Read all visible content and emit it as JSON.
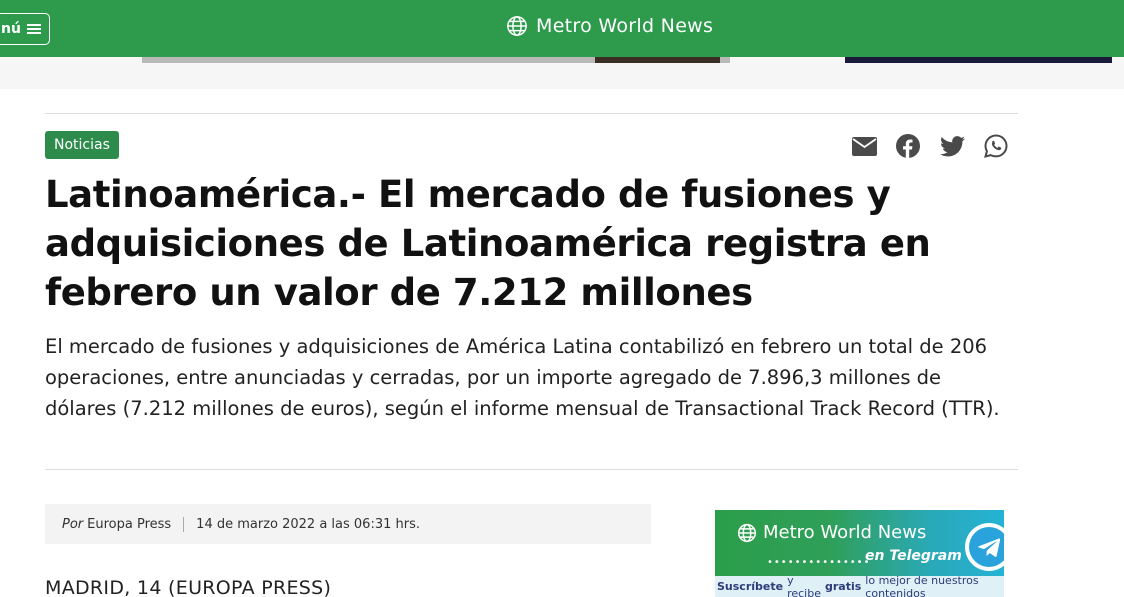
{
  "header": {
    "menu_label": "nú",
    "brand": "Metro World News"
  },
  "article": {
    "category": "Noticias",
    "title": "Latinoamérica.- El mercado de fusiones y adquisiciones de Latinoamérica registra en febrero un valor de 7.212 millones",
    "lede": "El mercado de fusiones y adquisiciones de América Latina contabilizó en febrero un total de 206 operaciones, entre anunciadas y cerradas, por un importe agregado de 7.896,3 millones de dólares (7.212 millones de euros), según el informe mensual de Transactional Track Record (TTR).",
    "byline_prefix": "Por",
    "author": "Europa Press",
    "date": "14 de marzo 2022 a las 06:31 hrs.",
    "dateline": "MADRID, 14 (EUROPA PRESS)"
  },
  "share_icons": [
    "email-icon",
    "facebook-icon",
    "twitter-icon",
    "whatsapp-icon"
  ],
  "promo": {
    "brand": "Metro World News",
    "dots": "•••••••••••••••",
    "channel": "en Telegram",
    "cta_a": "Suscríbete",
    "cta_b": "y recibe",
    "cta_c": "gratis",
    "cta_d": "lo mejor de nuestros contenidos"
  },
  "colors": {
    "brand_green": "#2d9a4c",
    "badge_green": "#2d8c4b",
    "telegram_blue": "#2aa3dd"
  }
}
